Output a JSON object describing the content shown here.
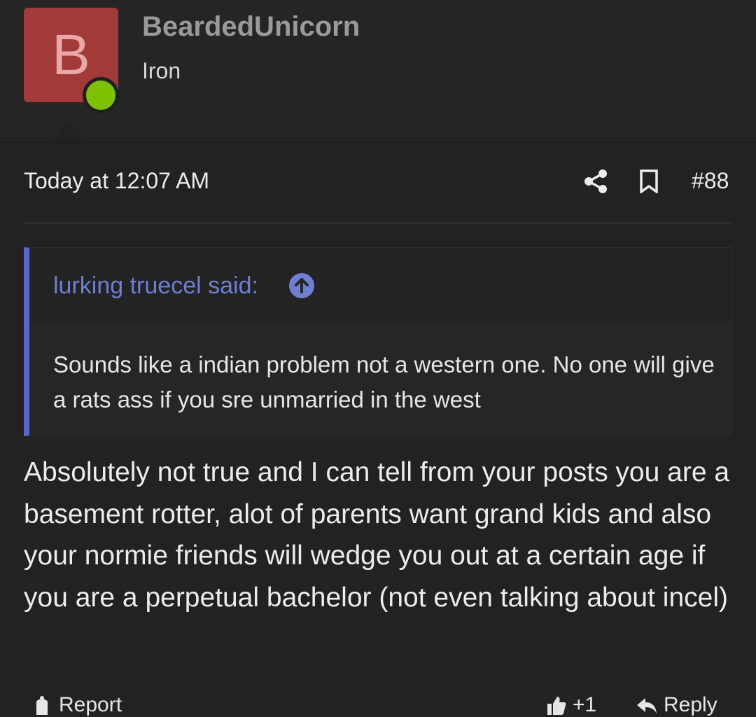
{
  "user": {
    "avatar_letter": "B",
    "name": "BeardedUnicorn",
    "title": "Iron",
    "avatar_color": "#a33a3a",
    "online_color": "#7cc200"
  },
  "post": {
    "time": "Today at 12:07 AM",
    "number": "#88",
    "body": "Absolutely not true and I can tell from your posts you are a basement rotter, alot of parents want grand kids and also your normie friends will wedge you out at a certain age if you are a perpetual bachelor (not even talking about incel)"
  },
  "quote": {
    "author": "lurking truecel said:",
    "text": "Sounds like a indian problem not a western one. No one will give a rats ass if you sre unmarried in the west",
    "accent_color": "#5b67c8"
  },
  "actions": {
    "report": "Report",
    "like": "+1",
    "reply": "Reply"
  },
  "icons": {
    "share": "share-icon",
    "bookmark": "bookmark-icon",
    "quote_jump": "arrow-up-circle-icon"
  }
}
